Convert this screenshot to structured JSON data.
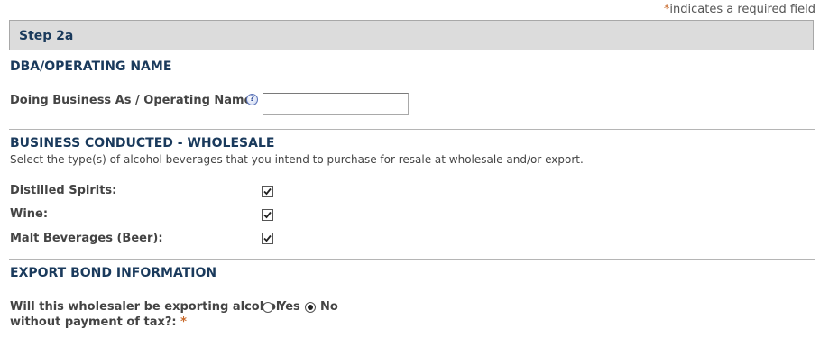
{
  "required_note": {
    "star": "*",
    "text": "indicates a required field"
  },
  "step": {
    "title": "Step 2a"
  },
  "dba_section": {
    "title": "DBA/OPERATING NAME",
    "field_label": "Doing Business As / Operating Name:",
    "help_icon": "question-mark-icon",
    "input_value": "",
    "input_placeholder": ""
  },
  "wholesale_section": {
    "title": "BUSINESS CONDUCTED - WHOLESALE",
    "description": "Select the type(s) of alcohol beverages that you intend to purchase for resale at wholesale and/or export.",
    "options": [
      {
        "label": "Distilled Spirits:",
        "checked": true
      },
      {
        "label": "Wine:",
        "checked": true
      },
      {
        "label": "Malt Beverages (Beer):",
        "checked": true
      }
    ]
  },
  "export_section": {
    "title": "EXPORT BOND INFORMATION",
    "question_line1": "Will this wholesaler be exporting alcohol",
    "question_line2": "without payment of tax?:",
    "required_star": "*",
    "radio_yes": "Yes",
    "radio_no": "No",
    "selected": "No"
  },
  "colors": {
    "heading": "#1a3a5c",
    "required_star": "#c8692a",
    "header_bg": "#dcdcdc"
  }
}
